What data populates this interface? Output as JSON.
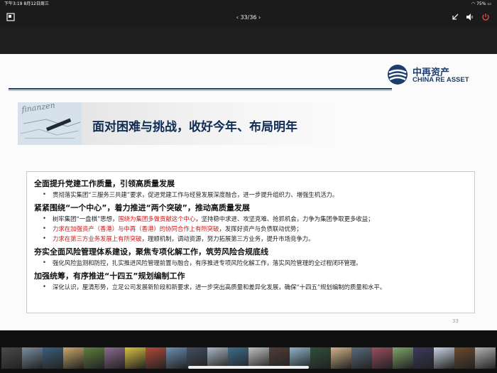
{
  "status_bar": {
    "time_date": "下午3:19  8月12日周三",
    "battery": "75%"
  },
  "toolbar": {
    "page_counter": "‹ 33/36 ›",
    "icons": [
      "screen-layout-icon",
      "shrink-icon",
      "volume-icon",
      "power-icon"
    ]
  },
  "slide": {
    "logo": {
      "cn": "中再资产",
      "en": "CHINA RE ASSET"
    },
    "photo_text": "finanzen",
    "headline": "面对困难与挑战，收好今年、布局明年",
    "page_number": "33",
    "sections": [
      {
        "heading": "全面提升党建工作质量，引领高质量发展",
        "bullets": [
          {
            "parts": [
              {
                "t": "贯彻落实集团“三服务三共建”要求，促进党建工作与经营发展深度融合，进一步提升组织力、增强生机活力。",
                "red": false
              }
            ]
          }
        ]
      },
      {
        "heading": "紧紧围绕“一个中心”，着力推进“两个突破”，推动高质量发展",
        "bullets": [
          {
            "parts": [
              {
                "t": "树牢集团“一盘棋”思想，",
                "red": false
              },
              {
                "t": "围绕为集团多做贡献这个中心",
                "red": true
              },
              {
                "t": "，坚持稳中求进、攻坚克难、抢抓机会，力争为集团争取更多收益；",
                "red": false
              }
            ]
          },
          {
            "parts": [
              {
                "t": "力求在加强资产（香港）与中再（香港）的协同合作上有所突破",
                "red": true
              },
              {
                "t": "，发挥好资产与负债联动优势；",
                "red": false
              }
            ]
          },
          {
            "parts": [
              {
                "t": "力求在第三方业务发展上有所突破",
                "red": true
              },
              {
                "t": "，理顺机制，调动资源，努力拓展第三方业务，提升市场竞争力。",
                "red": false
              }
            ]
          }
        ]
      },
      {
        "heading": "夯实全面风险管理体系建设，聚焦专项化解工作，筑劳风险合规底线",
        "bullets": [
          {
            "parts": [
              {
                "t": "强化风险监测和防控，扎实推进风险管理前置与融合，有序推进专项风险化解工作，落实风险管理的全过程闭环管理。",
                "red": false
              }
            ]
          }
        ]
      },
      {
        "heading": "加强统筹，有序推进“十四五”规划编制工作",
        "bullets": [
          {
            "parts": [
              {
                "t": "深化认识，厘清形势，立足公司发展新阶段和新要求，进一步突出高质量和差异化发展，确保“十四五”规划编制的质量和水平。",
                "red": false
              }
            ]
          }
        ]
      }
    ]
  },
  "dock": {
    "thumbnails": [
      {
        "label": "",
        "color": "#4a4a4a"
      },
      {
        "label": "",
        "color": "#7a8da1"
      },
      {
        "label": "",
        "color": "#3b5f7c"
      },
      {
        "label": "",
        "color": "#c9a86b"
      },
      {
        "label": "",
        "color": "#5f7f3d"
      },
      {
        "label": "",
        "color": "#8c6b8f"
      },
      {
        "label": "",
        "color": "#d8c141"
      },
      {
        "label": "",
        "color": "#b14a3a"
      },
      {
        "label": "",
        "color": "#6c8fb0"
      },
      {
        "label": "",
        "color": "#404f5f"
      },
      {
        "label": "",
        "color": "#a8b6c2"
      },
      {
        "label": "",
        "color": "#3d6e8f"
      },
      {
        "label": "",
        "color": "#c0c0c0"
      },
      {
        "label": "",
        "color": "#4f3e35"
      },
      {
        "label": "",
        "color": "#8db2c9"
      },
      {
        "label": "",
        "color": "#2f4f3a"
      },
      {
        "label": "",
        "color": "#d1b28a"
      },
      {
        "label": "",
        "color": "#5a6b7b"
      },
      {
        "label": "",
        "color": "#9a4e5f"
      },
      {
        "label": "",
        "color": "#7fa66a"
      },
      {
        "label": "",
        "color": "#3a3a5c"
      },
      {
        "label": "",
        "color": "#c7d4e2"
      },
      {
        "label": "",
        "color": "#6b4a2e"
      },
      {
        "label": "",
        "color": "#b2b2b2"
      }
    ]
  }
}
